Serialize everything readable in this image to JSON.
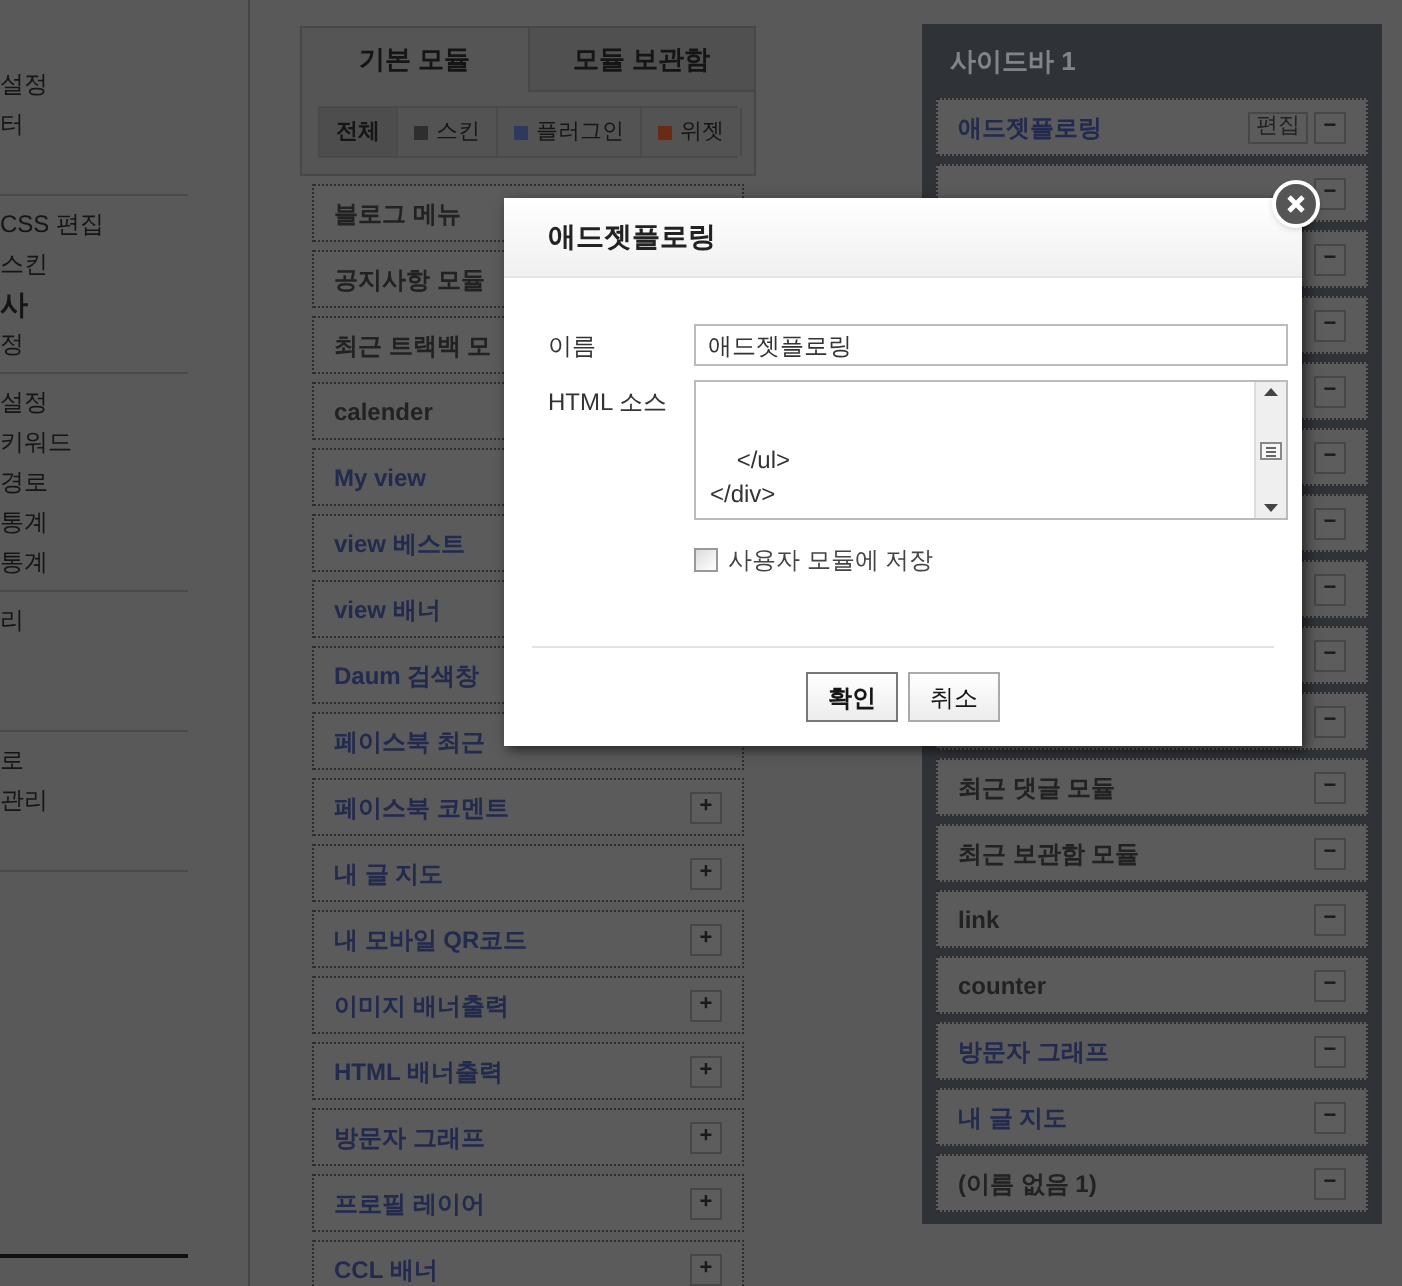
{
  "left_nav": {
    "sections": [
      {
        "items": [
          {
            "label": "설정",
            "kind": "item"
          },
          {
            "label": "터",
            "kind": "item"
          }
        ]
      },
      {
        "items": [
          {
            "label": "CSS 편집",
            "kind": "item"
          },
          {
            "label": "스킨",
            "kind": "item"
          },
          {
            "label": "사",
            "kind": "heading"
          },
          {
            "label": "정",
            "kind": "item"
          }
        ]
      },
      {
        "items": [
          {
            "label": "설정",
            "kind": "item"
          },
          {
            "label": "키워드",
            "kind": "item"
          },
          {
            "label": "경로",
            "kind": "item"
          },
          {
            "label": "통계",
            "kind": "item"
          },
          {
            "label": "통계",
            "kind": "item"
          }
        ]
      },
      {
        "items": [
          {
            "label": "리",
            "kind": "item"
          }
        ]
      },
      {
        "items": [
          {
            "label": "로",
            "kind": "item"
          },
          {
            "label": "관리",
            "kind": "item"
          }
        ]
      }
    ]
  },
  "module_tabs": [
    {
      "label": "기본 모듈",
      "selected": true
    },
    {
      "label": "모듈 보관함",
      "selected": false
    }
  ],
  "filters": [
    {
      "label": "전체",
      "selected": true
    },
    {
      "label": "스킨",
      "selected": false,
      "color": "#2e2e2e"
    },
    {
      "label": "플러그인",
      "selected": false,
      "color": "#2c3a60"
    },
    {
      "label": "위젯",
      "selected": false,
      "color": "#6a2a14"
    }
  ],
  "modules": [
    {
      "name": "블로그 메뉴",
      "color": "#222222"
    },
    {
      "name": "공지사항 모듈",
      "color": "#222222"
    },
    {
      "name": "최근 트랙백 모",
      "color": "#222222"
    },
    {
      "name": "calender",
      "color": "#222222"
    },
    {
      "name": "My view",
      "color": "#222a4e"
    },
    {
      "name": "view 베스트",
      "color": "#222a4e"
    },
    {
      "name": "view 배너",
      "color": "#222a4e"
    },
    {
      "name": "Daum 검색창",
      "color": "#222a4e"
    },
    {
      "name": "페이스북 최근",
      "color": "#222a4e"
    },
    {
      "name": "페이스북 코멘트",
      "color": "#222a4e",
      "add": "+"
    },
    {
      "name": "내 글 지도",
      "color": "#222a4e",
      "add": "+"
    },
    {
      "name": "내 모바일 QR코드",
      "color": "#222a4e",
      "add": "+"
    },
    {
      "name": "이미지 배너출력",
      "color": "#222a4e",
      "add": "+"
    },
    {
      "name": "HTML 배너출력",
      "color": "#222a4e",
      "add": "+"
    },
    {
      "name": "방문자 그래프",
      "color": "#222a4e",
      "add": "+"
    },
    {
      "name": "프로필 레이어",
      "color": "#222a4e",
      "add": "+"
    },
    {
      "name": "CCL 배너",
      "color": "#222a4e",
      "add": "+"
    }
  ],
  "sidebar": {
    "title": "사이드바 1",
    "rows": [
      {
        "name": "애드젯플로링",
        "color": "#222a4e",
        "edit": "편집",
        "remove": "−"
      },
      {
        "remove": "−"
      },
      {
        "remove": "−"
      },
      {
        "remove": "−"
      },
      {
        "remove": "−"
      },
      {
        "remove": "−"
      },
      {
        "remove": "−"
      },
      {
        "remove": "−"
      },
      {
        "remove": "−"
      },
      {
        "remove": "−"
      },
      {
        "name": "최근 댓글 모듈",
        "color": "#222222",
        "remove": "−"
      },
      {
        "name": "최근 보관함 모듈",
        "color": "#222222",
        "remove": "−"
      },
      {
        "name": "link",
        "color": "#222222",
        "remove": "−"
      },
      {
        "name": "counter",
        "color": "#222222",
        "remove": "−"
      },
      {
        "name": "방문자 그래프",
        "color": "#222a4e",
        "remove": "−"
      },
      {
        "name": "내 글 지도",
        "color": "#222a4e",
        "remove": "−"
      },
      {
        "name": "(이름 없음 1)",
        "color": "#222222",
        "remove": "−"
      }
    ]
  },
  "dialog": {
    "title": "애드젯플로링",
    "name_label": "이름",
    "name_value": "애드젯플로링",
    "source_label": "HTML 소스",
    "source_lines": [
      "    </ul>",
      "</div>"
    ],
    "save_checkbox": {
      "label": "사용자 모듈에 저장",
      "checked": false
    },
    "buttons": [
      {
        "label": "확인",
        "kind": "primary"
      },
      {
        "label": "취소",
        "kind": "secondary"
      }
    ]
  }
}
